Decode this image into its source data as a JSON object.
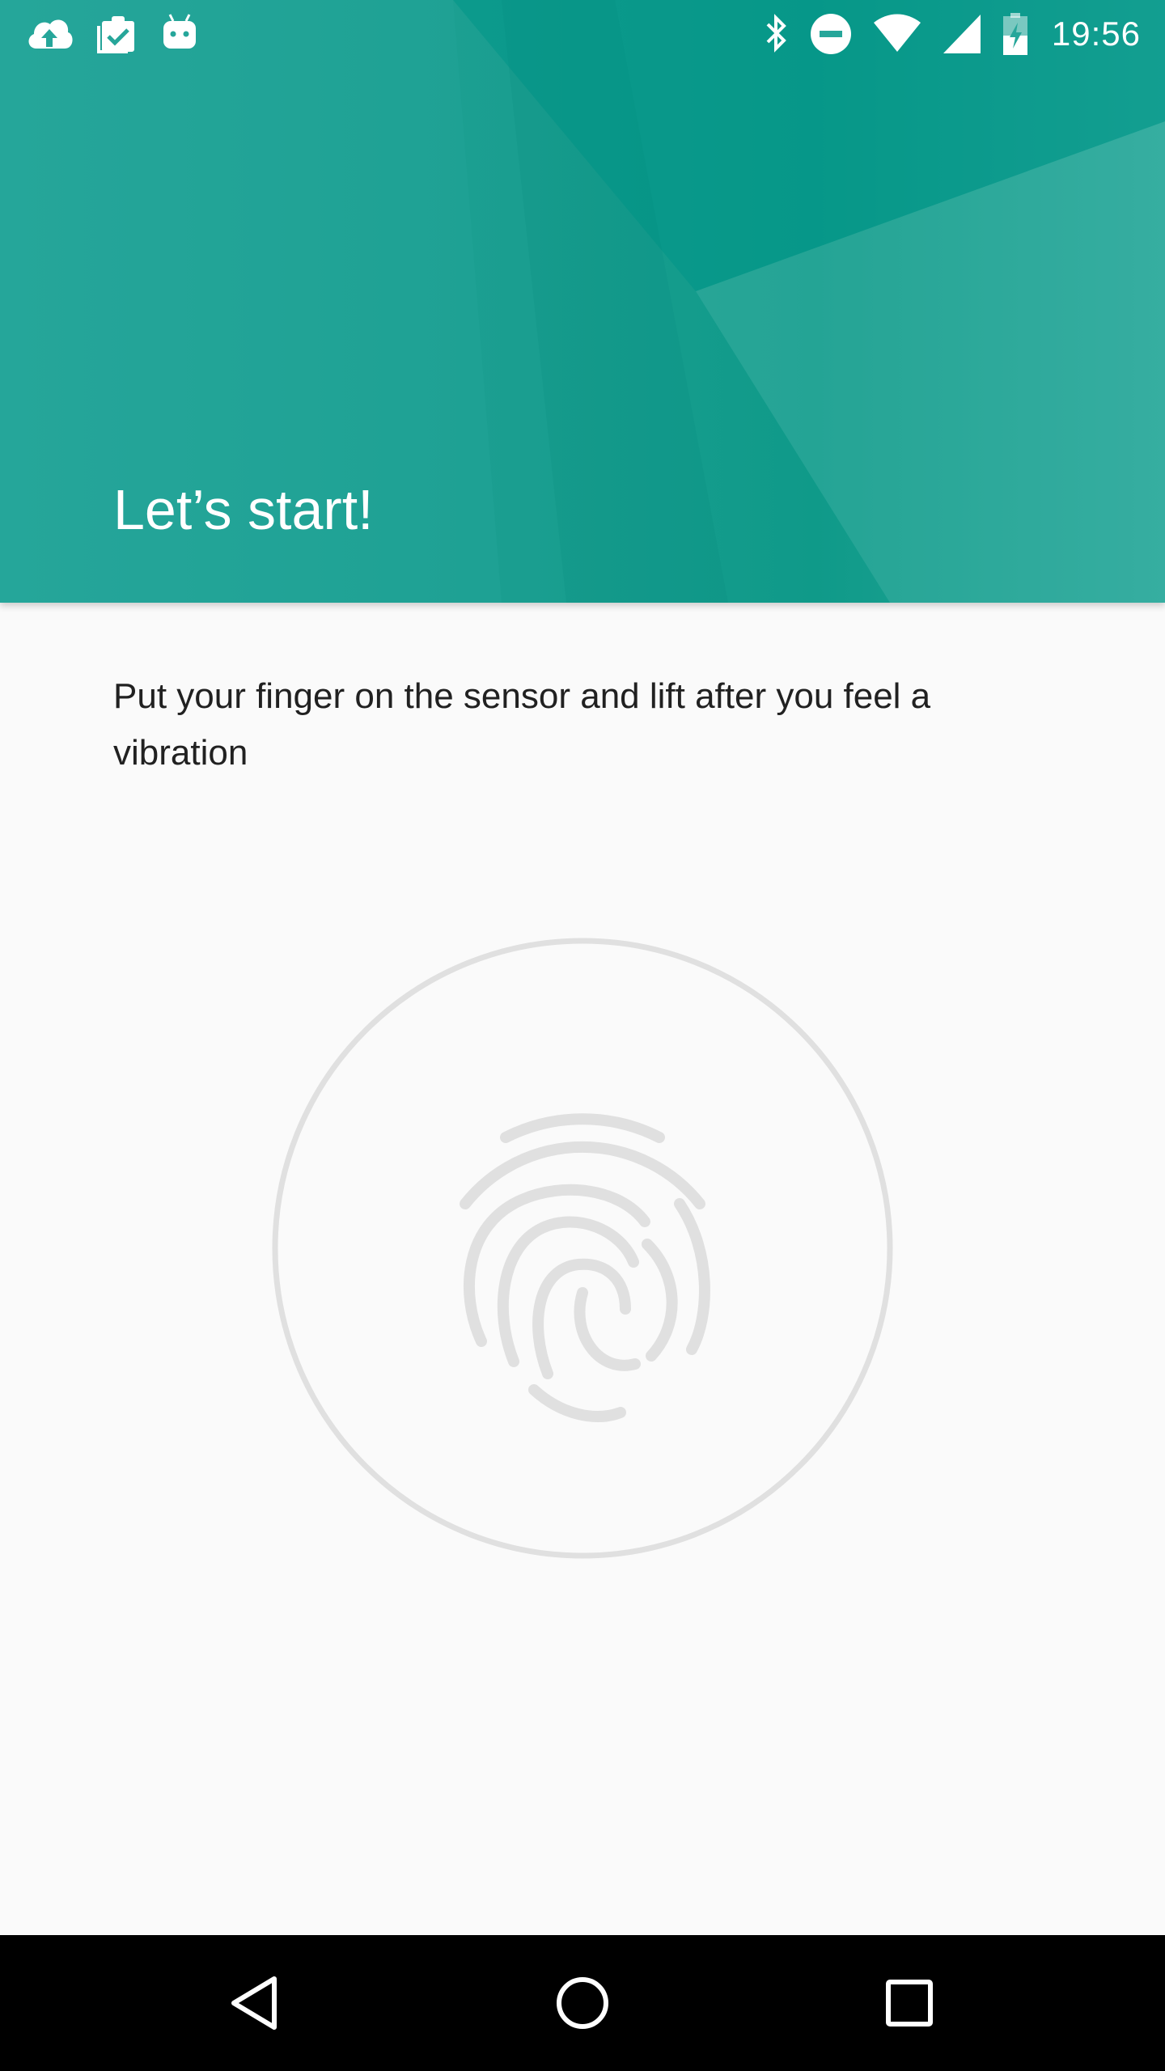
{
  "status_bar": {
    "time": "19:56",
    "left_icons": [
      "cloud-upload-icon",
      "clipboard-check-icon",
      "android-icon"
    ],
    "right_icons": [
      "bluetooth-icon",
      "do-not-disturb-icon",
      "wifi-icon",
      "cell-signal-icon",
      "battery-charging-icon"
    ]
  },
  "header": {
    "title": "Let’s start!",
    "accent_color": "#009688"
  },
  "main": {
    "instruction": "Put your finger on the sensor and lift after you feel a vibration",
    "sensor_icon": "fingerprint-icon"
  },
  "nav_bar": {
    "buttons": [
      "back-icon",
      "home-icon",
      "recents-icon"
    ]
  }
}
